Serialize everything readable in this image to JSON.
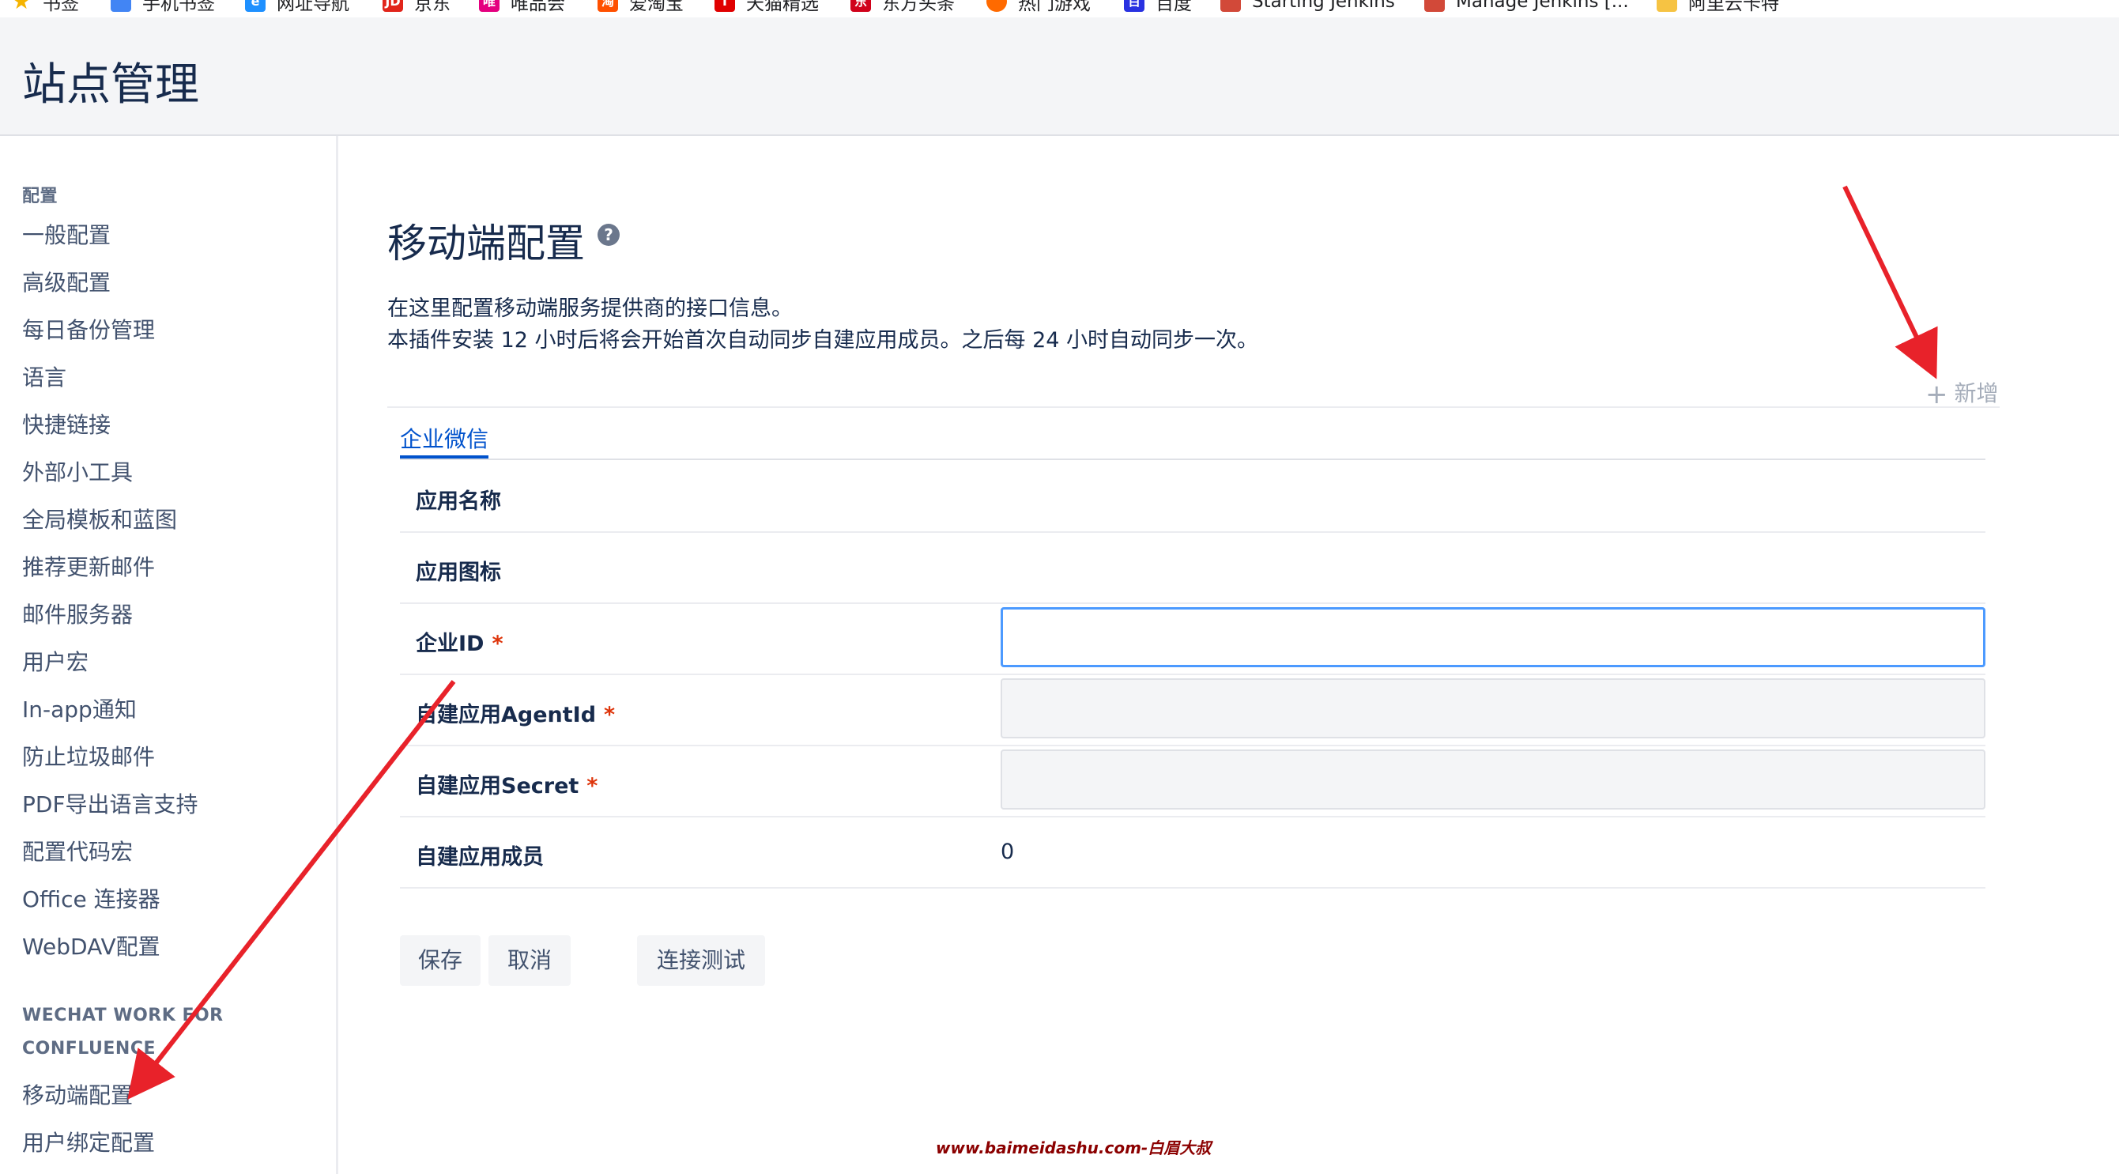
{
  "bookmarks": [
    {
      "label": "书签",
      "icon": "star-icon",
      "color": "#f5b400"
    },
    {
      "label": "手机书签",
      "icon": "mobile-bookmark-icon",
      "color": "#4285f4"
    },
    {
      "label": "网址导航",
      "icon": "nav-e-icon",
      "color": "#1e90ff"
    },
    {
      "label": "京东",
      "icon": "jd-icon",
      "color": "#e1251b"
    },
    {
      "label": "唯品会",
      "icon": "vip-icon",
      "color": "#e4007f"
    },
    {
      "label": "爱淘宝",
      "icon": "taobao-icon",
      "color": "#ff5000"
    },
    {
      "label": "天猫精选",
      "icon": "tmall-icon",
      "color": "#e00000"
    },
    {
      "label": "东方头条",
      "icon": "toutiao-icon",
      "color": "#d0021b"
    },
    {
      "label": "热门游戏",
      "icon": "game-icon",
      "color": "#ff6a00"
    },
    {
      "label": "百度",
      "icon": "baidu-paw-icon",
      "color": "#2932e1"
    },
    {
      "label": "Starting Jenkins",
      "icon": "jenkins-icon",
      "color": "#d24939"
    },
    {
      "label": "Manage Jenkins [...",
      "icon": "jenkins-icon",
      "color": "#d24939"
    },
    {
      "label": "阿里云卡特",
      "icon": "folder-icon",
      "color": "#f6c343"
    }
  ],
  "header": {
    "title": "站点管理"
  },
  "sidebar": {
    "section1": "配置",
    "items": [
      "一般配置",
      "高级配置",
      "每日备份管理",
      "语言",
      "快捷链接",
      "外部小工具",
      "全局模板和蓝图",
      "推荐更新邮件",
      "邮件服务器",
      "用户宏",
      "In-app通知",
      "防止垃圾邮件",
      "PDF导出语言支持",
      "配置代码宏",
      "Office 连接器",
      "WebDAV配置"
    ],
    "section2_line1": "WECHAT WORK FOR",
    "section2_line2": "CONFLUENCE",
    "items2": [
      "移动端配置",
      "用户绑定配置"
    ]
  },
  "main": {
    "title": "移动端配置",
    "help": "?",
    "desc1": "在这里配置移动端服务提供商的接口信息。",
    "desc2": "本插件安装 12 小时后将会开始首次自动同步自建应用成员。之后每 24 小时自动同步一次。",
    "add_label": "新增",
    "add_icon": "+",
    "tab": "企业微信",
    "fields": {
      "app_name": "应用名称",
      "app_icon": "应用图标",
      "corp_id": "企业ID",
      "agent_id": "自建应用AgentId",
      "secret": "自建应用Secret",
      "members": "自建应用成员",
      "members_value": "0",
      "required_mark": "*"
    },
    "buttons": {
      "save": "保存",
      "cancel": "取消",
      "test": "连接测试"
    }
  },
  "watermark": "www.baimeidashu.com-白眉大叔",
  "colors": {
    "accent": "#0052cc",
    "focus": "#4c9aff",
    "required": "#de350b",
    "annotation_arrow": "#e8222a"
  }
}
